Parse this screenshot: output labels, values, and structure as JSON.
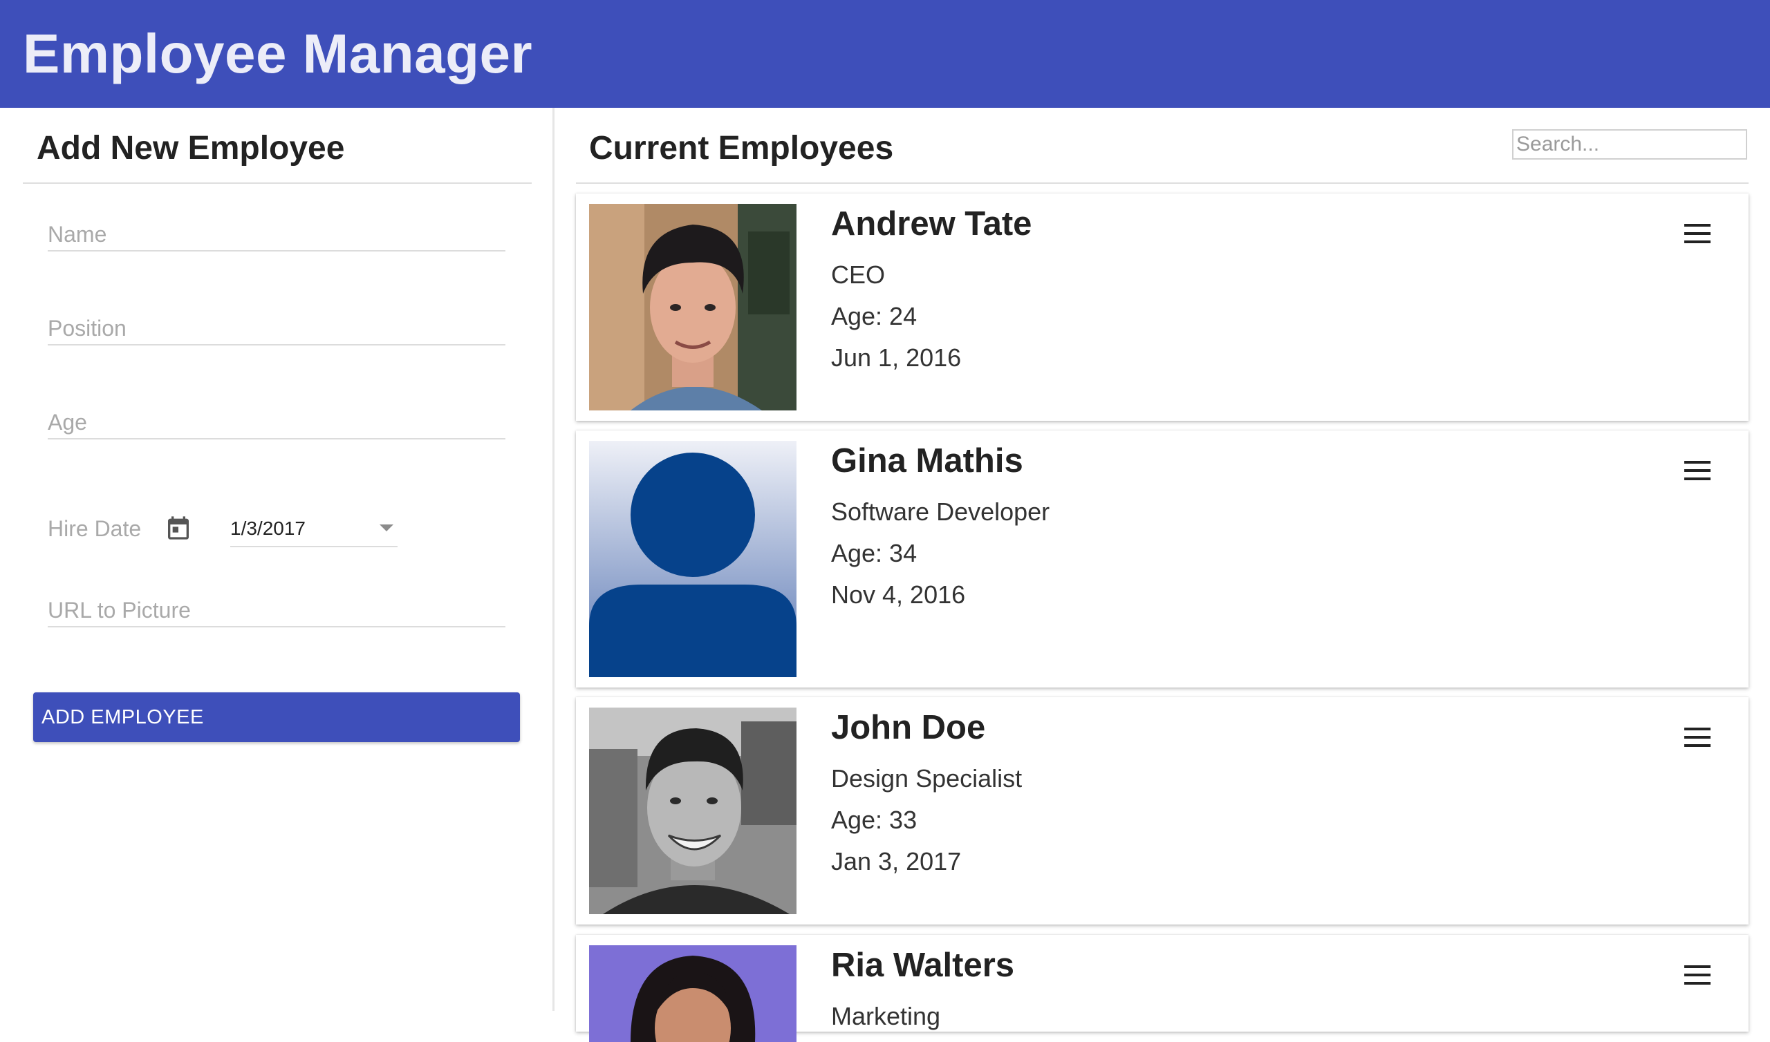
{
  "app": {
    "title": "Employee Manager",
    "brand_color": "#3e4fba"
  },
  "add_form": {
    "title": "Add New Employee",
    "name_placeholder": "Name",
    "position_placeholder": "Position",
    "age_placeholder": "Age",
    "hire_date_label": "Hire Date",
    "hire_date_value": "1/3/2017",
    "url_placeholder": "URL to Picture",
    "submit_label": "ADD EMPLOYEE"
  },
  "employees_panel": {
    "title": "Current Employees",
    "search_placeholder": "Search..."
  },
  "employees": [
    {
      "name": "Andrew Tate",
      "position": "CEO",
      "age": "Age: 24",
      "hire_date": "Jun 1, 2016",
      "photo": "photo-young-man-dark-hair"
    },
    {
      "name": "Gina Mathis",
      "position": "Software Developer",
      "age": "Age: 34",
      "hire_date": "Nov 4, 2016",
      "photo": "default-avatar-silhouette"
    },
    {
      "name": "John Doe",
      "position": "Design Specialist",
      "age": "Age: 33",
      "hire_date": "Jan 3, 2017",
      "photo": "photo-smiling-man-grayscale"
    },
    {
      "name": "Ria Walters",
      "position": "Marketing",
      "age": "",
      "hire_date": "",
      "photo": "photo-woman-dark-hair"
    }
  ]
}
